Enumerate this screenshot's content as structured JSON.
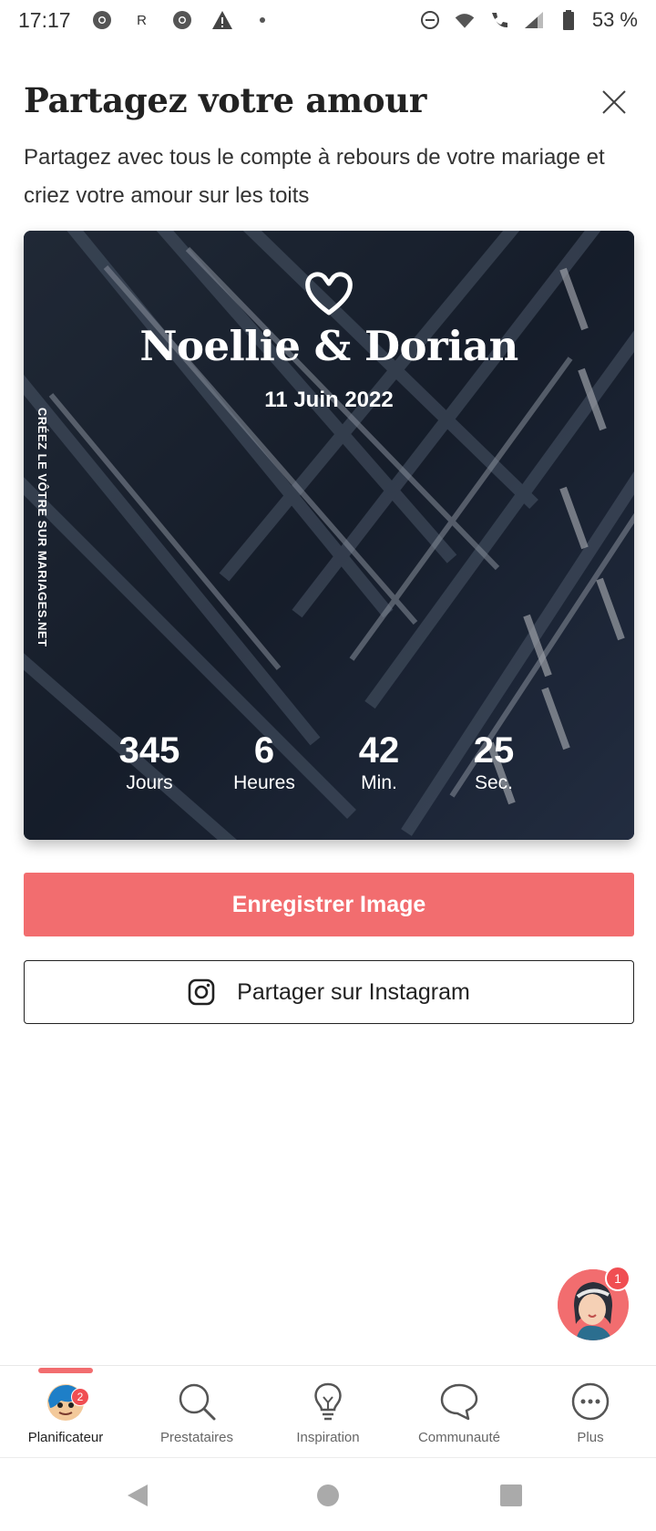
{
  "status_bar": {
    "time": "17:17",
    "notif_letter": "R",
    "battery": "53 %"
  },
  "header": {
    "title": "Partagez votre amour",
    "subtitle": "Partagez avec tous le compte à rebours de votre mariage et criez votre amour sur les toits"
  },
  "card": {
    "names": "Noellie & Dorian",
    "date": "11 Juin 2022",
    "vertical_text": "CRÉEZ LE VÔTRE SUR MARIAGES.NET",
    "countdown": [
      {
        "value": "345",
        "label": "Jours"
      },
      {
        "value": "6",
        "label": "Heures"
      },
      {
        "value": "42",
        "label": "Min."
      },
      {
        "value": "25",
        "label": "Sec."
      }
    ]
  },
  "actions": {
    "save_label": "Enregistrer Image",
    "instagram_label": "Partager sur Instagram"
  },
  "chat": {
    "badge": "1"
  },
  "bottom_nav": {
    "items": [
      {
        "label": "Planificateur",
        "icon": "avatar-icon",
        "badge": "2",
        "active": true
      },
      {
        "label": "Prestataires",
        "icon": "search-icon"
      },
      {
        "label": "Inspiration",
        "icon": "lightbulb-icon"
      },
      {
        "label": "Communauté",
        "icon": "chat-bubble-icon"
      },
      {
        "label": "Plus",
        "icon": "more-icon"
      }
    ]
  },
  "colors": {
    "accent": "#f26d6f",
    "card_bg": "#1e2633"
  }
}
